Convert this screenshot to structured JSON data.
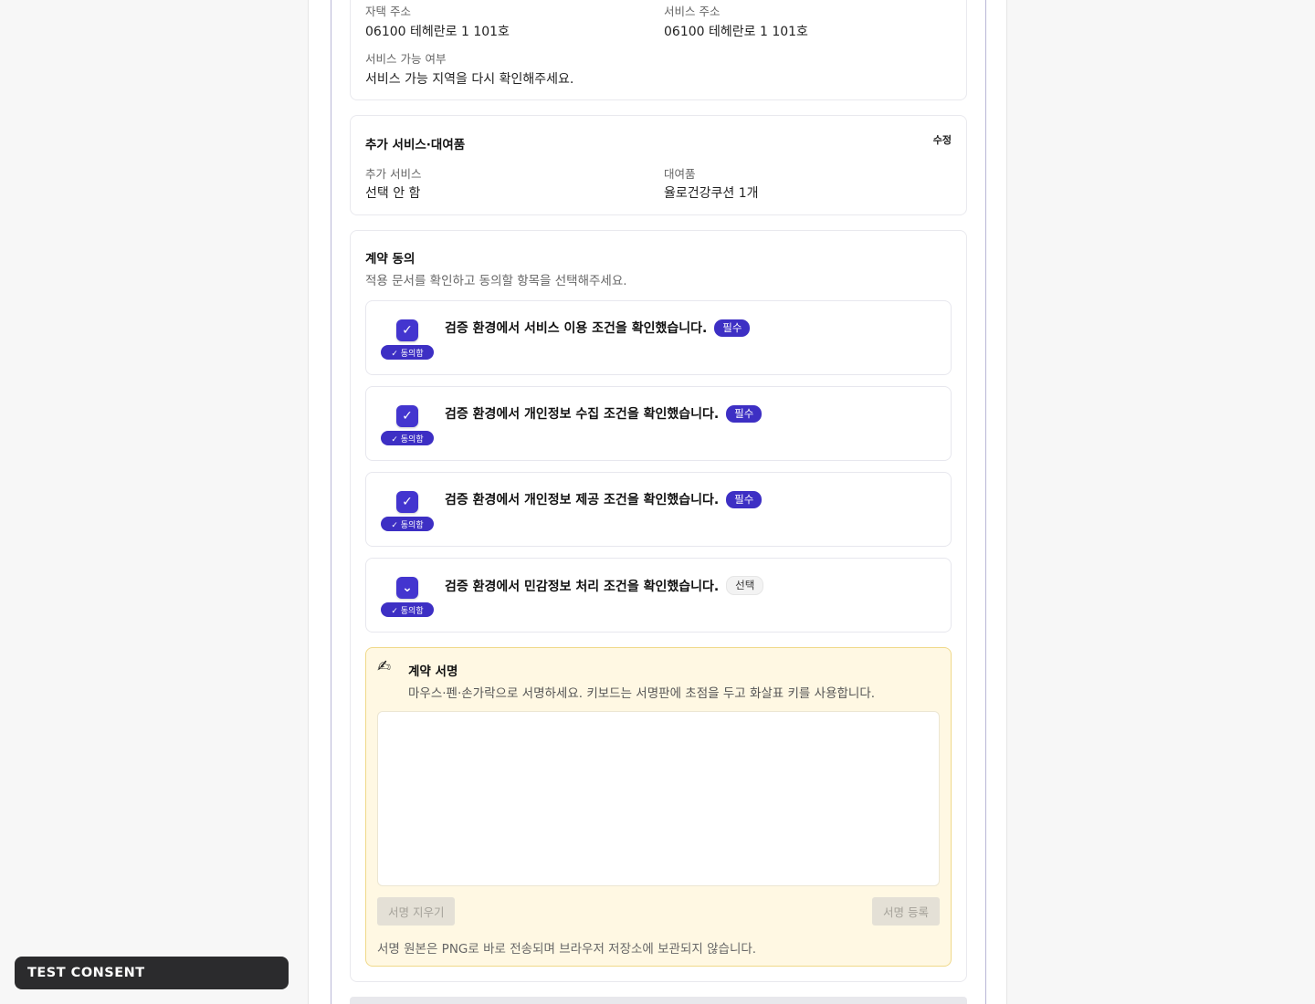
{
  "address_card": {
    "home_address_label": "자택 주소",
    "home_address_value": "06100 테헤란로 1 101호",
    "service_address_label": "서비스 주소",
    "service_address_value": "06100 테헤란로 1 101호",
    "availability_label": "서비스 가능 여부",
    "availability_value": "서비스 가능 지역을 다시 확인해주세요."
  },
  "extras_card": {
    "title": "추가 서비스·대여품",
    "edit_label": "수정",
    "extra_service_label": "추가 서비스",
    "extra_service_value": "선택 안 함",
    "rental_label": "대여품",
    "rental_value": "율로건강쿠션 1개"
  },
  "consent_card": {
    "title": "계약 동의",
    "subtitle": "적용 문서를 확인하고 동의할 항목을 선택해주세요.",
    "items": [
      {
        "text": "검증 환경에서 서비스 이용 조건을 확인했습니다.",
        "badge": "필수",
        "agree": "✓ 동의함",
        "check": "✓"
      },
      {
        "text": "검증 환경에서 개인정보 수집 조건을 확인했습니다.",
        "badge": "필수",
        "agree": "✓ 동의함",
        "check": "✓"
      },
      {
        "text": "검증 환경에서 개인정보 제공 조건을 확인했습니다.",
        "badge": "필수",
        "agree": "✓ 동의함",
        "check": "✓"
      },
      {
        "text": "검증 환경에서 민감정보 처리 조건을 확인했습니다.",
        "badge": "선택",
        "agree": "✓ 동의함",
        "check": "⌄"
      }
    ],
    "signature": {
      "icon": "✍",
      "title": "계약 서명",
      "instructions": "마우스·펜·손가락으로 서명하세요. 키보드는 서명판에 초점을 두고 화살표 키를 사용합니다.",
      "clear_label": "서명 지우기",
      "submit_label": "서명 등록",
      "note": "서명 원본은 PNG로 바로 전송되며 브라우저 저장소에 보관되지 않습니다."
    }
  },
  "toast": {
    "label": "TEST CONSENT"
  },
  "colors": {
    "accent": "#3d2fc4",
    "signature_bg": "#fff8e3",
    "toast_bg": "#2b2b2d"
  }
}
